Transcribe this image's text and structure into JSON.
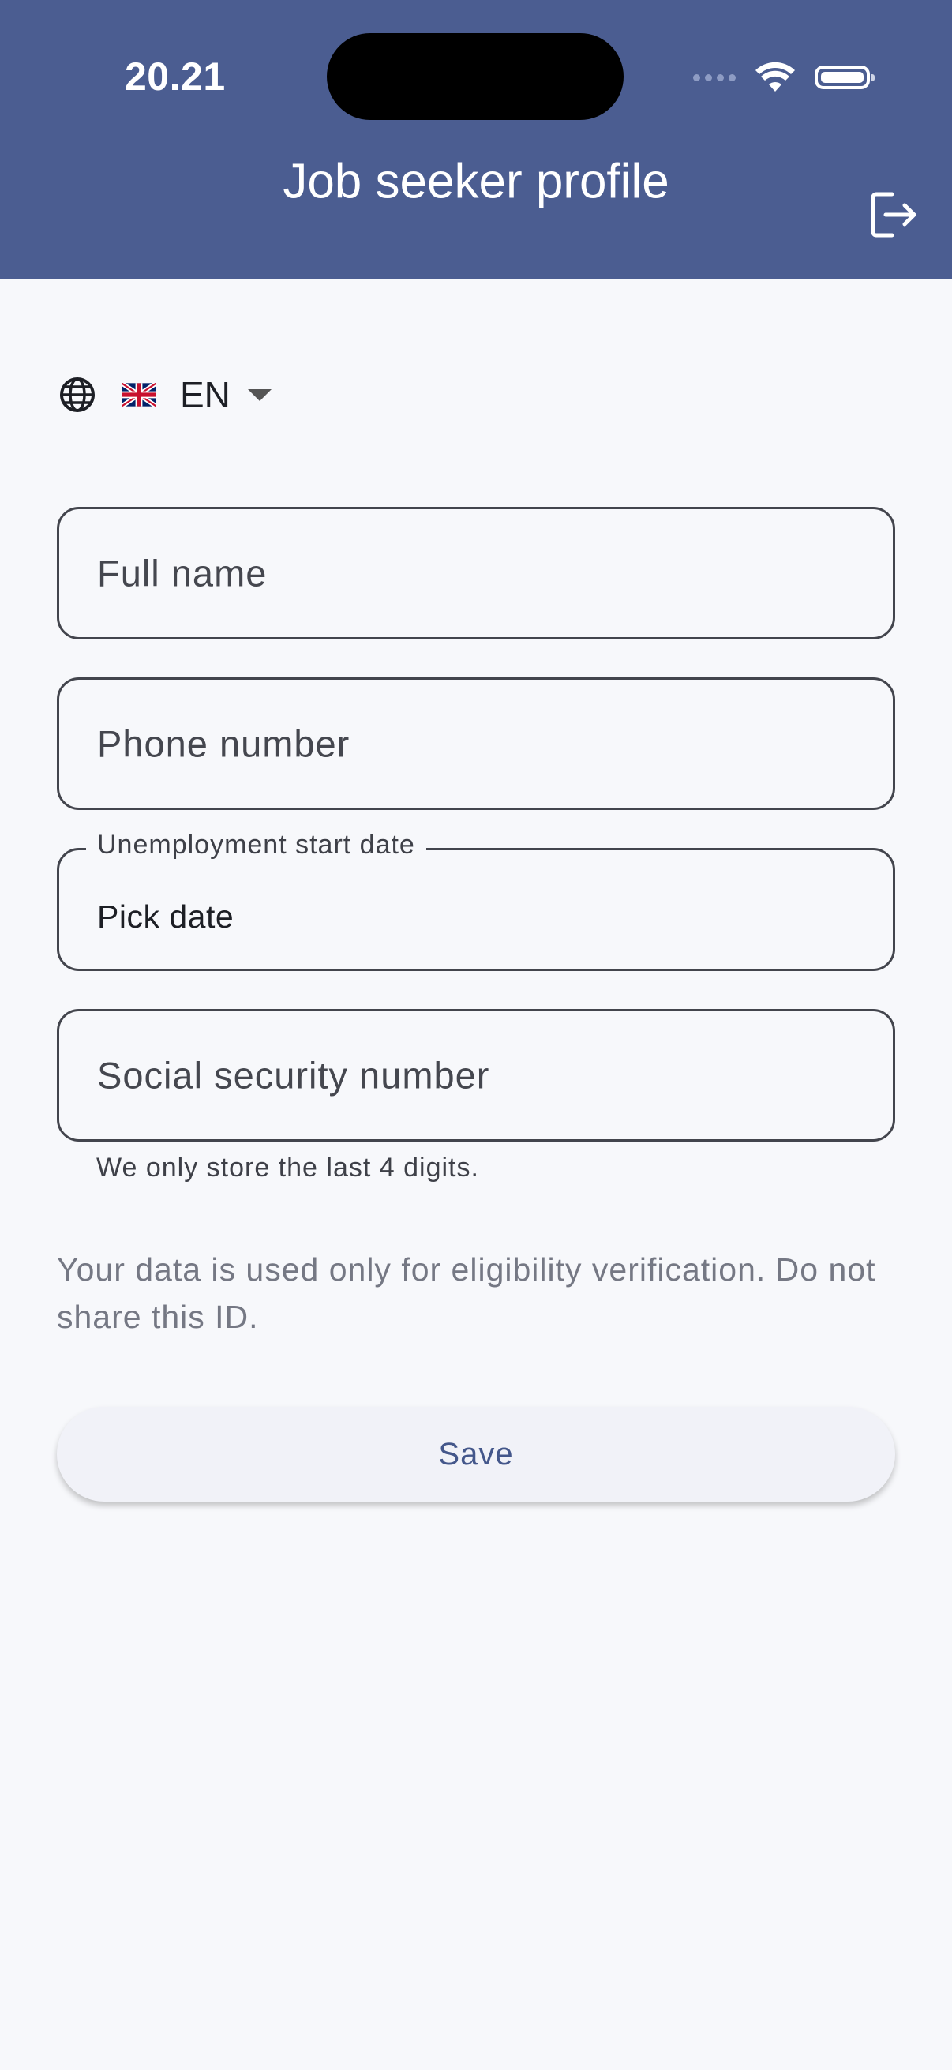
{
  "status_bar": {
    "time": "20.21"
  },
  "header": {
    "title": "Job seeker profile",
    "logout_icon": "logout-icon"
  },
  "language": {
    "code": "EN",
    "flag": "uk-flag-icon",
    "icon": "globe-icon"
  },
  "form": {
    "full_name": {
      "placeholder": "Full name"
    },
    "phone": {
      "placeholder": "Phone number"
    },
    "start_date": {
      "label": "Unemployment start date",
      "value": "Pick date"
    },
    "ssn": {
      "placeholder": "Social security number",
      "helper": "We only store the last 4 digits."
    },
    "notice": "Your data is used only for eligibility verification. Do not share this ID.",
    "save_label": "Save"
  },
  "colors": {
    "header": "#4b5d91",
    "background": "#f7f8fb",
    "accent": "#44578b"
  }
}
